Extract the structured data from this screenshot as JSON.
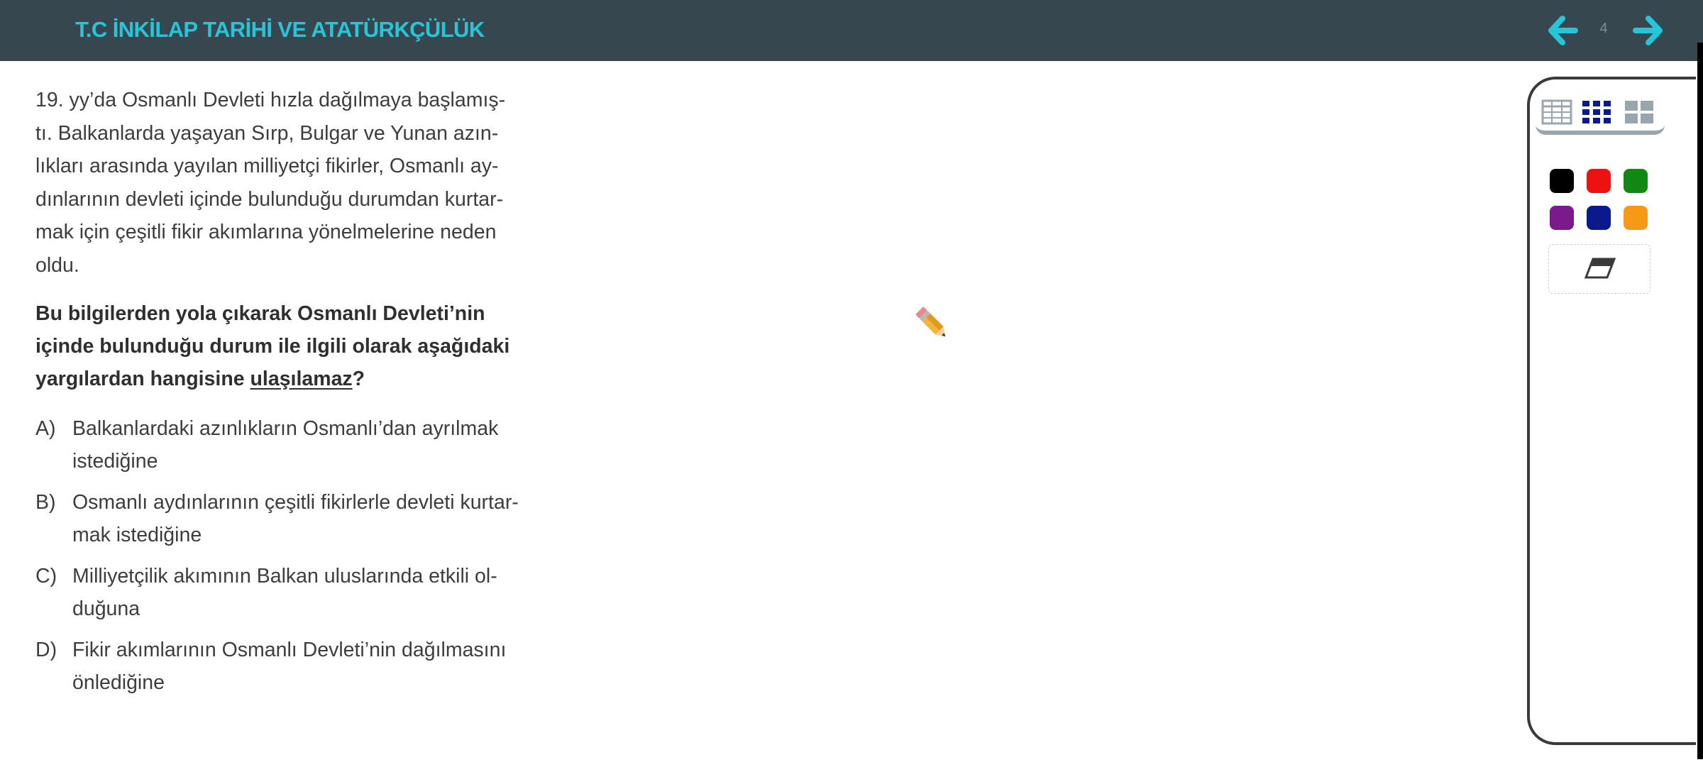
{
  "header": {
    "title": "T.C İNKİLAP TARİHİ VE ATATÜRKÇÜLÜK",
    "page_number": "4",
    "prev_icon": "arrow-left-icon",
    "next_icon": "arrow-right-icon"
  },
  "question": {
    "stem_lines": [
      "19. yy’da Osmanlı Devleti hızla dağılmaya başlamış-",
      "tı. Balkanlarda yaşayan Sırp, Bulgar ve Yunan azın-",
      "lıkları arasında yayılan milliyetçi fikirler, Osmanlı ay-",
      "dınlarının devleti içinde bulunduğu durumdan kurtar-",
      "mak için çeşitli fikir akımlarına yönelmelerine neden",
      "oldu."
    ],
    "prompt_lines": [
      "Bu bilgilerden yola çıkarak Osmanlı Devleti’nin",
      "içinde bulunduğu durum ile ilgili olarak aşağıdaki"
    ],
    "prompt_last_prefix": "yargılardan hangisine ",
    "prompt_last_underlined": "ulaşılamaz",
    "prompt_last_suffix": "?",
    "options": [
      {
        "letter": "A)",
        "line1": "Balkanlardaki azınlıkların Osmanlı’dan ayrılmak",
        "line2": "istediğine"
      },
      {
        "letter": "B)",
        "line1": "Osmanlı aydınlarının çeşitli fikirlerle devleti kurtar-",
        "line2": "mak istediğine"
      },
      {
        "letter": "C)",
        "line1": "Milliyetçilik akımının Balkan uluslarında etkili ol-",
        "line2": "duğuna"
      },
      {
        "letter": "D)",
        "line1": "Fikir akımlarının Osmanlı Devleti’nin dağılmasını",
        "line2": "önlediğine"
      }
    ]
  },
  "toolbar": {
    "grid_tabs": [
      "table-grid-icon",
      "dot-grid-icon",
      "block-grid-icon"
    ],
    "active_grid_tab": "dot-grid-icon",
    "colors": [
      "#000000",
      "#ee1111",
      "#118811",
      "#7b1a8a",
      "#0a1a8c",
      "#f59a16"
    ],
    "eraser_icon": "eraser-icon",
    "pen_icon": "pencil-icon"
  },
  "colors": {
    "header_bg": "#37474f",
    "accent": "#26c6da"
  }
}
